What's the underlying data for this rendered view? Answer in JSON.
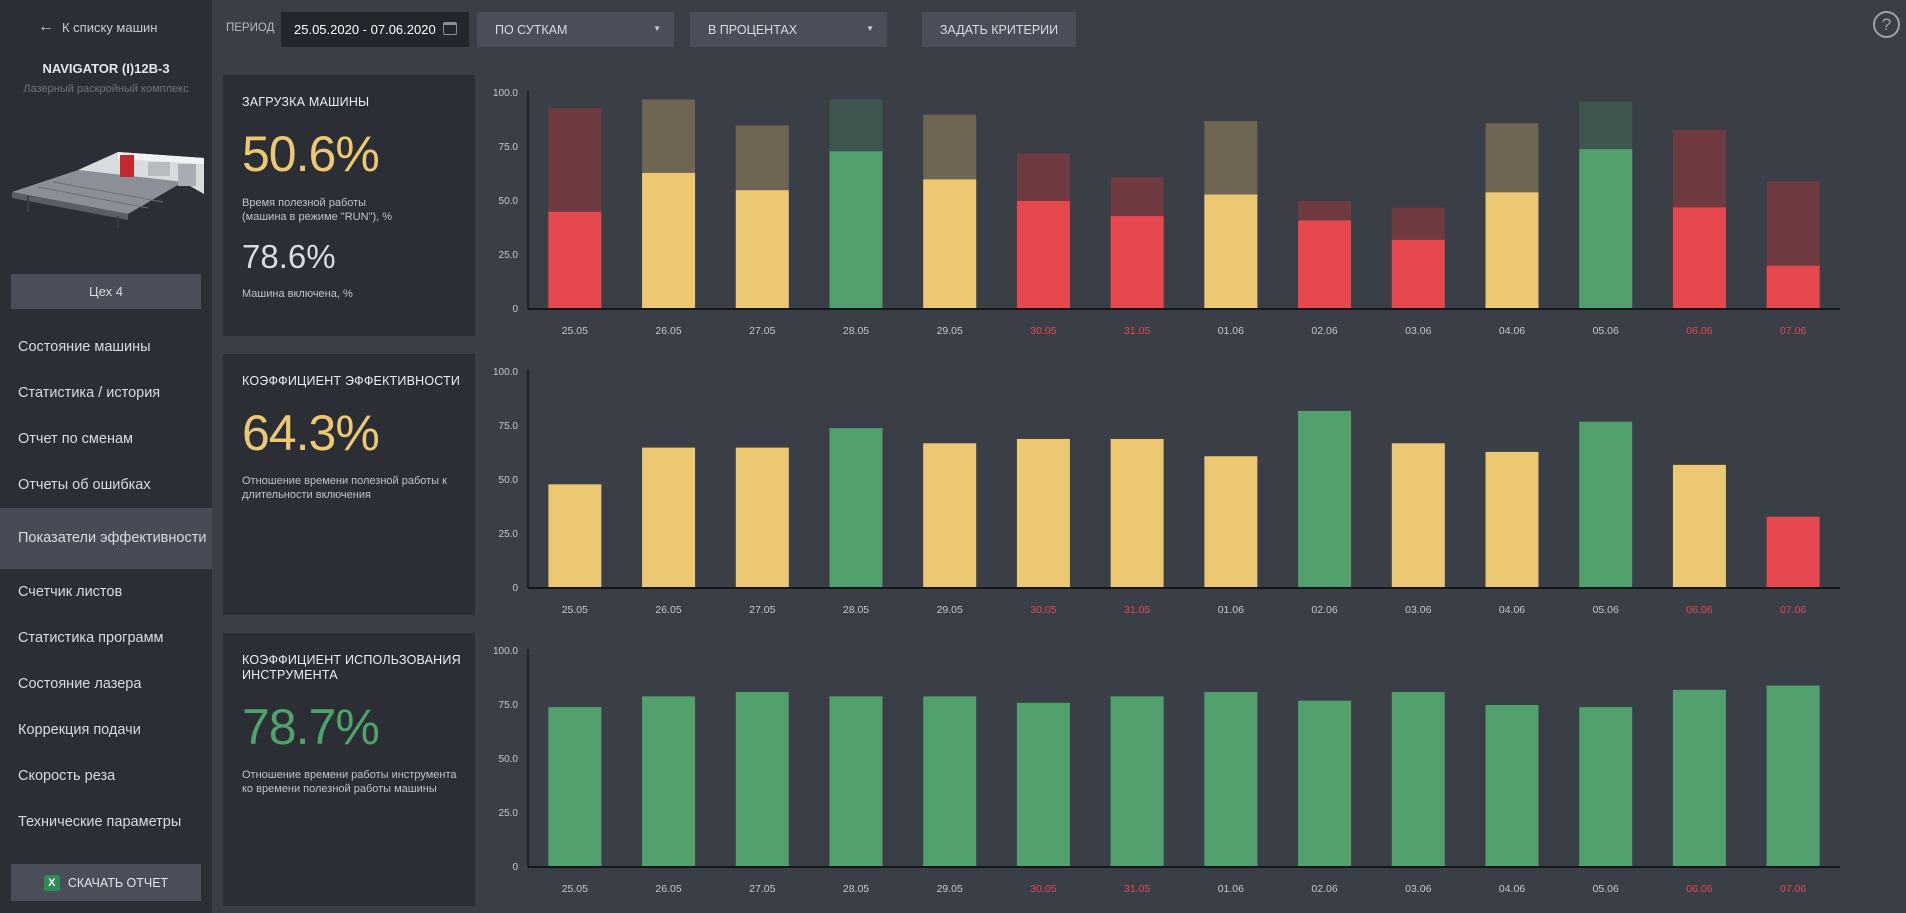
{
  "sidebar": {
    "back_label": "К списку машин",
    "machine_name": "NAVIGATOR (I)12B-3",
    "machine_sub": "Лазерный раскройный комплекс",
    "workshop": "Цех 4",
    "menu": [
      "Состояние машины",
      "Статистика / история",
      "Отчет по сменам",
      "Отчеты об ошибках",
      "Показатели эффективности",
      "Счетчик листов",
      "Статистика программ",
      "Состояние лазера",
      "Коррекция подачи",
      "Скорость реза",
      "Технические параметры"
    ],
    "active_index": 4,
    "download_label": "СКАЧАТЬ ОТЧЕТ",
    "download_icon": "excel-icon"
  },
  "toolbar": {
    "period_label": "ПЕРИОД",
    "date_range": "25.05.2020 - 07.06.2020",
    "granularity": "ПО СУТКАМ",
    "units": "В ПРОЦЕНТАХ",
    "criteria_label": "ЗАДАТЬ КРИТЕРИИ",
    "help_icon": "question-icon"
  },
  "kpi": {
    "load": {
      "title": "ЗАГРУЗКА МАШИНЫ",
      "value": "50.6%",
      "value_desc": "Время полезной работы (машина в режиме \"RUN\"), %",
      "secondary": "78.6%",
      "secondary_desc": "Машина включена, %"
    },
    "efficiency": {
      "title": "КОЭФФИЦИЕНТ ЭФФЕКТИВНОСТИ",
      "value": "64.3%",
      "value_desc": "Отношение времени полезной работы к длительности включения"
    },
    "tool": {
      "title": "КОЭФФИЦИЕНТ ИСПОЛЬЗОВАНИЯ ИНСТРУМЕНТА",
      "value": "78.7%",
      "value_desc": "Отношение времени работы инструмента ко времени полезной работы машины"
    }
  },
  "colors": {
    "red": "#e5484e",
    "yellow": "#ecc873",
    "green": "#52a06e",
    "red_dim": "#6f3a40",
    "yellow_dim": "#6e6552",
    "green_dim": "#3f5650",
    "kpi_yellow": "#ecc873",
    "kpi_green": "#4fa36a"
  },
  "chart_data": [
    {
      "type": "bar",
      "name": "load",
      "categories": [
        "25.05",
        "26.05",
        "27.05",
        "28.05",
        "29.05",
        "30.05",
        "31.05",
        "01.06",
        "02.06",
        "03.06",
        "04.06",
        "05.06",
        "06.06",
        "07.06"
      ],
      "weekend": [
        false,
        false,
        false,
        false,
        false,
        true,
        true,
        false,
        false,
        false,
        false,
        false,
        true,
        true
      ],
      "series": [
        {
          "role": "useful_work",
          "values": [
            45,
            63,
            55,
            73,
            60,
            50,
            43,
            53,
            41,
            32,
            54,
            74,
            47,
            20
          ]
        },
        {
          "role": "switched_on",
          "values": [
            93,
            97,
            85,
            97,
            90,
            72,
            61,
            87,
            50,
            47,
            86,
            96,
            83,
            59
          ]
        }
      ],
      "bar_colors": [
        "red",
        "yellow",
        "yellow",
        "green",
        "yellow",
        "red",
        "red",
        "yellow",
        "red",
        "red",
        "yellow",
        "green",
        "red",
        "red"
      ],
      "yticks": [
        "0",
        "25.0",
        "50.0",
        "75.0",
        "100.0"
      ],
      "ylim": [
        0,
        100
      ]
    },
    {
      "type": "bar",
      "name": "efficiency",
      "categories": [
        "25.05",
        "26.05",
        "27.05",
        "28.05",
        "29.05",
        "30.05",
        "31.05",
        "01.06",
        "02.06",
        "03.06",
        "04.06",
        "05.06",
        "06.06",
        "07.06"
      ],
      "weekend": [
        false,
        false,
        false,
        false,
        false,
        true,
        true,
        false,
        false,
        false,
        false,
        false,
        true,
        true
      ],
      "series": [
        {
          "values": [
            48,
            65,
            65,
            74,
            67,
            69,
            69,
            61,
            82,
            67,
            63,
            77,
            57,
            33
          ]
        }
      ],
      "bar_colors": [
        "yellow",
        "yellow",
        "yellow",
        "green",
        "yellow",
        "yellow",
        "yellow",
        "yellow",
        "green",
        "yellow",
        "yellow",
        "green",
        "yellow",
        "red"
      ],
      "yticks": [
        "0",
        "25.0",
        "50.0",
        "75.0",
        "100.0"
      ],
      "ylim": [
        0,
        100
      ]
    },
    {
      "type": "bar",
      "name": "tool",
      "categories": [
        "25.05",
        "26.05",
        "27.05",
        "28.05",
        "29.05",
        "30.05",
        "31.05",
        "01.06",
        "02.06",
        "03.06",
        "04.06",
        "05.06",
        "06.06",
        "07.06"
      ],
      "weekend": [
        false,
        false,
        false,
        false,
        false,
        true,
        true,
        false,
        false,
        false,
        false,
        false,
        true,
        true
      ],
      "series": [
        {
          "values": [
            74,
            79,
            81,
            79,
            79,
            76,
            79,
            81,
            77,
            81,
            75,
            74,
            82,
            84
          ]
        }
      ],
      "bar_colors": [
        "green",
        "green",
        "green",
        "green",
        "green",
        "green",
        "green",
        "green",
        "green",
        "green",
        "green",
        "green",
        "green",
        "green"
      ],
      "yticks": [
        "0",
        "25.0",
        "50.0",
        "75.0",
        "100.0"
      ],
      "ylim": [
        0,
        100
      ]
    }
  ]
}
